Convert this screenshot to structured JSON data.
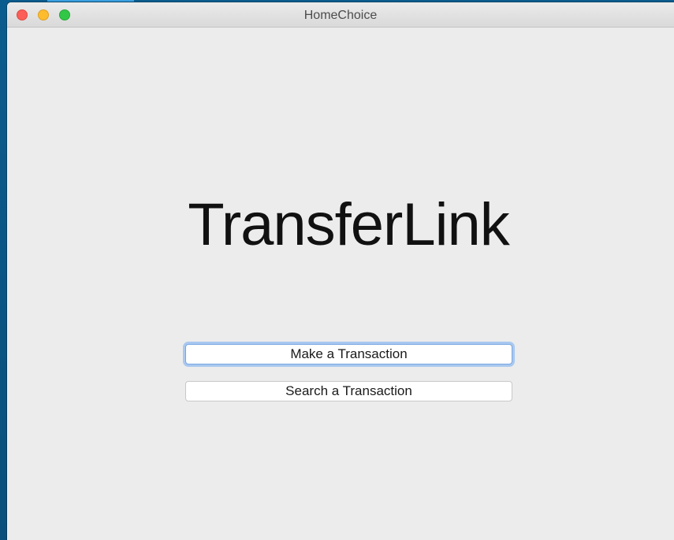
{
  "window": {
    "title": "HomeChoice"
  },
  "main": {
    "app_title": "TransferLink",
    "buttons": [
      {
        "label": "Make a Transaction"
      },
      {
        "label": "Search a Transaction"
      }
    ]
  },
  "colors": {
    "desktop": "#0b5c8e",
    "window_bg": "#ececec",
    "close": "#fc5f57",
    "minimize": "#fdbc2e",
    "maximize": "#33c748",
    "focus_ring": "#a9c8f0"
  }
}
